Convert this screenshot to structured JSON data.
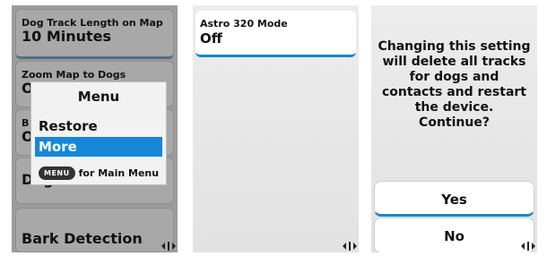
{
  "screen1": {
    "items": [
      {
        "label": "Dog Track Length on Map",
        "value": "10 Minutes"
      },
      {
        "label": "Zoom Map to Dogs",
        "value": "O"
      },
      {
        "label": "B",
        "value": "O"
      },
      {
        "label": "Dog Alerts"
      },
      {
        "label": "Bark Detection"
      }
    ],
    "menu": {
      "title": "Menu",
      "options": [
        "Restore Defaults",
        "More"
      ],
      "hint_button": "MENU",
      "hint_text": "for Main Menu"
    }
  },
  "screen2": {
    "label": "Astro 320 Mode",
    "value": "Off"
  },
  "screen3": {
    "message_lines": [
      "Changing this setting",
      "will delete all tracks",
      "for dogs and",
      "contacts and restart",
      "the device.",
      "Continue?"
    ],
    "yes_label": "Yes",
    "no_label": "No"
  },
  "icons": {
    "scroll": "scroll-arrows-icon"
  },
  "colors": {
    "highlight": "#1687d8",
    "selected_border": "#1a87c9"
  }
}
